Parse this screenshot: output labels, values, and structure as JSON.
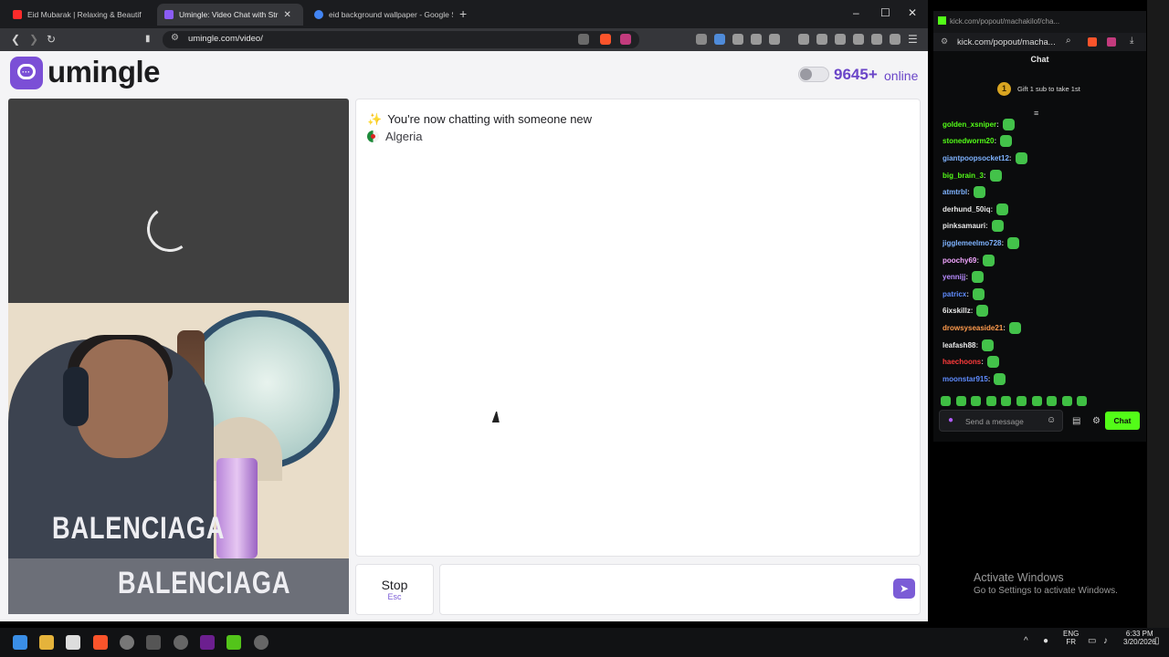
{
  "browser": {
    "tabs": [
      {
        "label": "Eid Mubarak | Relaxing & Beautif",
        "active": false,
        "favicon_color": "#ff2b2b"
      },
      {
        "label": "Umingle: Video Chat with Str",
        "active": true,
        "favicon_color": "#8b5cf6"
      },
      {
        "label": "eid background wallpaper - Google S",
        "active": false,
        "favicon_color": "#4285f4"
      }
    ],
    "new_tab": "+",
    "window_controls": {
      "minimize": "–",
      "maximize": "☐",
      "close": "✕"
    },
    "toolbar": {
      "back": "❮",
      "forward": "❯",
      "reload": "↻",
      "bookmark": "🔖",
      "url": "umingle.com/video/"
    }
  },
  "umingle": {
    "logo_text": "umingle",
    "online_count": "9645+",
    "online_label": "online",
    "chat": {
      "status_icon": "✨",
      "status": "You're now chatting with someone new",
      "country": "Algeria"
    },
    "shirt_text": "BALENCIAGA",
    "stop_label": "Stop",
    "stop_key": "Esc",
    "send_icon": "➤"
  },
  "kick": {
    "window_title": "kick.com/popout/machakilof/cha...",
    "address": "kick.com/popout/macha...",
    "header": "Chat",
    "gift_rank": "1",
    "gift_text": "Gift 1 sub to take 1st",
    "messages": [
      {
        "user": "golden_xsniper",
        "color": "#53fc18"
      },
      {
        "user": "stonedworm20",
        "color": "#53fc18"
      },
      {
        "user": "giantpoopsocket12",
        "color": "#7fb3ff"
      },
      {
        "user": "big_brain_3",
        "color": "#53fc18"
      },
      {
        "user": "atmtrbl",
        "color": "#7fb3ff"
      },
      {
        "user": "derhund_50iq",
        "color": "#eaeaea"
      },
      {
        "user": "pinksamauri",
        "color": "#eaeaea"
      },
      {
        "user": "jigglemeelmo728",
        "color": "#7fb3ff"
      },
      {
        "user": "poochy69",
        "color": "#f2a6ff"
      },
      {
        "user": "yennijj",
        "color": "#b98cff"
      },
      {
        "user": "patricx",
        "color": "#5f8cff"
      },
      {
        "user": "6ixskillz",
        "color": "#eaeaea"
      },
      {
        "user": "drowsyseaside21",
        "color": "#ff9b4d"
      },
      {
        "user": "leafash88",
        "color": "#eaeaea"
      },
      {
        "user": "haechoons",
        "color": "#ff3b3b"
      },
      {
        "user": "moonstar915",
        "color": "#5f8cff"
      }
    ],
    "input_placeholder": "Send a message",
    "chat_button": "Chat"
  },
  "desktop": {
    "activate_title": "Activate Windows",
    "activate_sub": "Go to Settings to activate Windows.",
    "tray": {
      "lang_top": "ENG",
      "lang_bottom": "FR",
      "time": "6:33 PM",
      "date": "3/20/2026"
    }
  }
}
